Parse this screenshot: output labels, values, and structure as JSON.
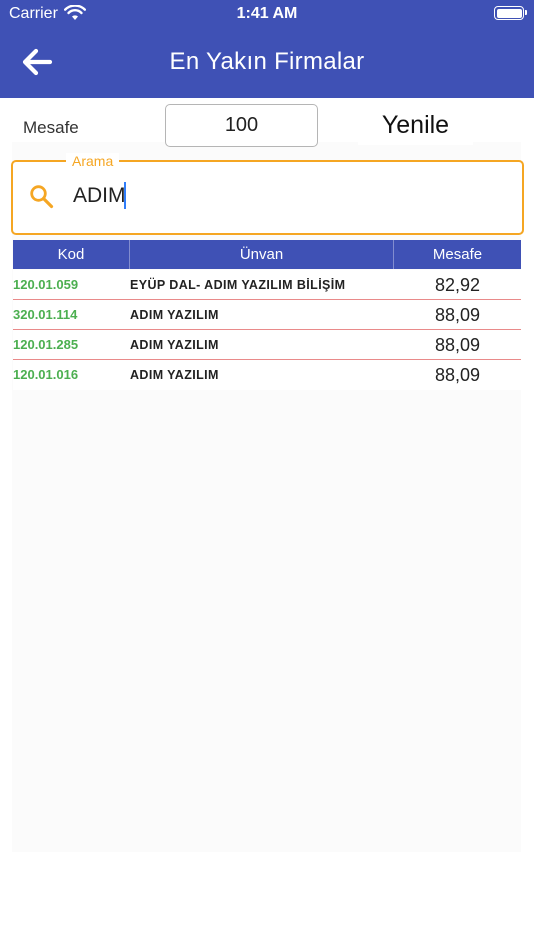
{
  "status_bar": {
    "carrier": "Carrier",
    "time": "1:41 AM"
  },
  "header": {
    "title": "En Yakın Firmalar",
    "back_icon": "arrow-left-icon"
  },
  "filters": {
    "distance_label": "Mesafe",
    "distance_value": "100",
    "refresh_label": "Yenile",
    "search_legend": "Arama",
    "search_value": "ADIM",
    "search_icon": "search-icon"
  },
  "colors": {
    "primary": "#3f51b5",
    "accent": "#f5a623",
    "code": "#4caf50",
    "divider": "#e98a8a"
  },
  "table": {
    "columns": [
      "Kod",
      "Ünvan",
      "Mesafe"
    ],
    "rows": [
      {
        "kod": "120.01.059",
        "unvan": "EYÜP DAL- ADIM YAZILIM BİLİŞİM",
        "mesafe": "82,92"
      },
      {
        "kod": "320.01.114",
        "unvan": "ADIM YAZILIM",
        "mesafe": "88,09"
      },
      {
        "kod": "120.01.285",
        "unvan": "ADIM YAZILIM",
        "mesafe": "88,09"
      },
      {
        "kod": "120.01.016",
        "unvan": "ADIM YAZILIM",
        "mesafe": "88,09"
      }
    ]
  }
}
